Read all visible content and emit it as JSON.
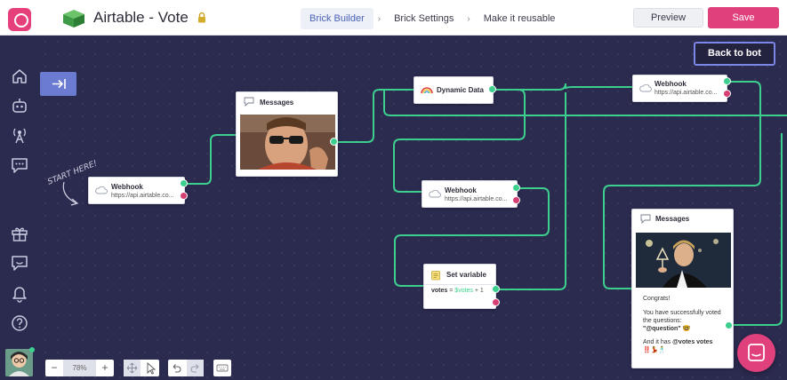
{
  "header": {
    "bot_title": "Airtable - Vote",
    "tabs": [
      {
        "label": "Brick Builder",
        "active": true
      },
      {
        "label": "Brick Settings",
        "active": false
      },
      {
        "label": "Make it reusable",
        "active": false
      }
    ],
    "tab_separator": "›",
    "preview_label": "Preview",
    "save_label": "Save"
  },
  "sidebar": {
    "icons": [
      "home-icon",
      "bot-icon",
      "broadcast-icon",
      "chat-icon",
      "gift-icon",
      "feedback-icon",
      "bell-icon",
      "help-icon"
    ]
  },
  "canvas": {
    "back_to_bot_label": "Back to bot",
    "start_label": "START HERE!",
    "nodes": {
      "webhook_start": {
        "title": "Webhook",
        "subtitle": "https://api.airtable.co..."
      },
      "messages_1": {
        "title": "Messages"
      },
      "dynamic_data": {
        "title": "Dynamic Data"
      },
      "webhook_mid": {
        "title": "Webhook",
        "subtitle": "https://api.airtable.co..."
      },
      "set_variable": {
        "title": "Set variable",
        "expr_var": "votes",
        "expr_op": "=",
        "expr_rhs": "$votes",
        "expr_plus": "+ 1"
      },
      "webhook_top": {
        "title": "Webhook",
        "subtitle": "https://api.airtable.co..."
      },
      "messages_2": {
        "title": "Messages",
        "line1": "Congrats!",
        "line2": "You have successfully voted the questions:",
        "line3": "\"@question\" 🤓",
        "line4": "And it has",
        "line4_bold": "@votes votes",
        "line5": "‼️💃🕺"
      }
    }
  },
  "toolbar": {
    "zoom_minus": "−",
    "zoom_value": "78%",
    "zoom_plus": "+"
  },
  "colors": {
    "canvas_bg": "#2b2a4f",
    "accent_pink": "#e0407b",
    "wire_green": "#3ccf8e",
    "port_red": "#d63e73",
    "collapse_blue": "#6c7bd2"
  }
}
